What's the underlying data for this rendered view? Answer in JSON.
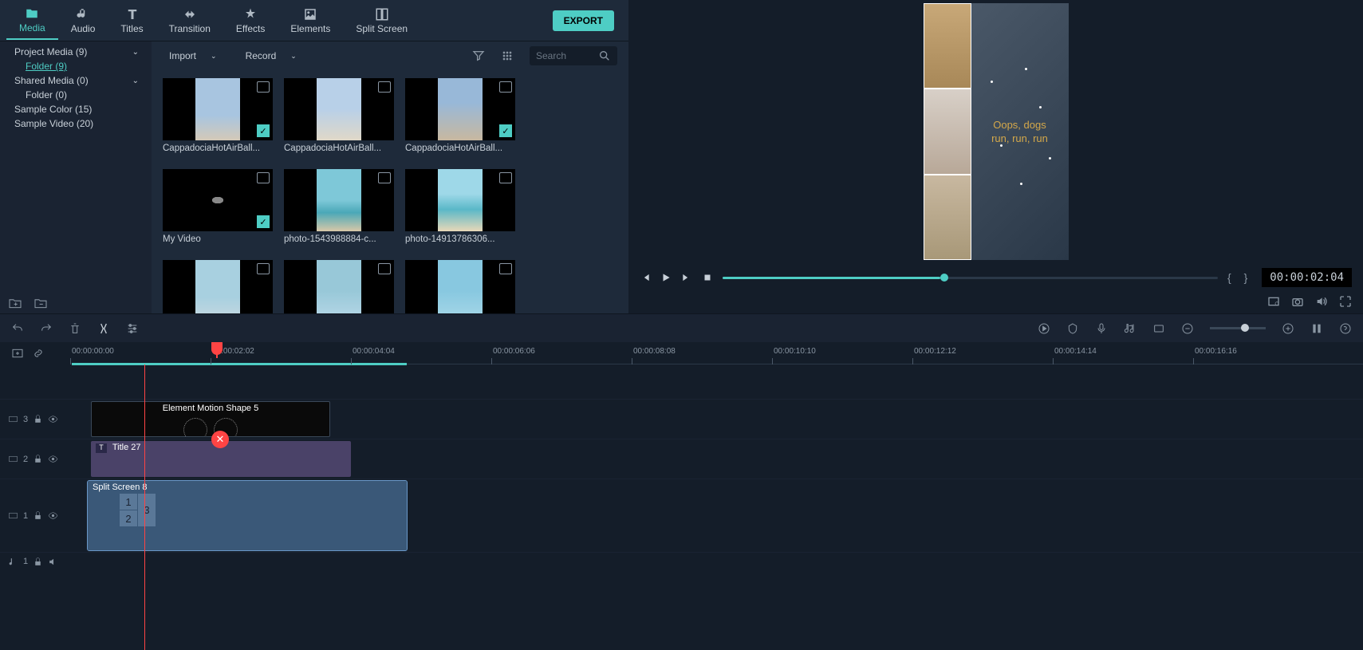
{
  "tabs": [
    "Media",
    "Audio",
    "Titles",
    "Transition",
    "Effects",
    "Elements",
    "Split Screen"
  ],
  "active_tab": 0,
  "export_label": "EXPORT",
  "sidebar": {
    "items": [
      {
        "label": "Project Media (9)",
        "expandable": true
      },
      {
        "label": "Folder (9)",
        "nested": true,
        "active": true
      },
      {
        "label": "Shared Media (0)",
        "expandable": true
      },
      {
        "label": "Folder (0)",
        "nested": true
      },
      {
        "label": "Sample Color (15)"
      },
      {
        "label": "Sample Video (20)"
      }
    ]
  },
  "media_toolbar": {
    "import_label": "Import",
    "record_label": "Record",
    "search_placeholder": "Search"
  },
  "media_items": [
    {
      "label": "CappadociaHotAirBall...",
      "thumb_class": "sky1",
      "type": "img",
      "checked": true
    },
    {
      "label": "CappadociaHotAirBall...",
      "thumb_class": "sky2",
      "type": "img"
    },
    {
      "label": "CappadociaHotAirBall...",
      "thumb_class": "sky3",
      "type": "img",
      "checked": true
    },
    {
      "label": "My Video",
      "thumb_class": "birds",
      "type": "vid",
      "checked": true,
      "wide": true
    },
    {
      "label": "photo-1543988884-c...",
      "thumb_class": "beach1",
      "type": "img"
    },
    {
      "label": "photo-14913786306...",
      "thumb_class": "beach2",
      "type": "img"
    },
    {
      "label": "",
      "thumb_class": "beach3",
      "type": "img"
    },
    {
      "label": "",
      "thumb_class": "beach4",
      "type": "img"
    },
    {
      "label": "",
      "thumb_class": "palm",
      "type": "img"
    }
  ],
  "preview": {
    "overlay_text_line1": "Oops, dogs",
    "overlay_text_line2": "run, run, run",
    "timecode": "00:00:02:04"
  },
  "ruler_marks": [
    "00:00:00:00",
    "00:00:02:02",
    "00:00:04:04",
    "00:00:06:06",
    "00:00:08:08",
    "00:00:10:10",
    "00:00:12:12",
    "00:00:14:14",
    "00:00:16:16"
  ],
  "tracks": {
    "t3": {
      "label": "3",
      "clip_label": "Element Motion Shape 5"
    },
    "t2": {
      "label": "2",
      "clip_label": "Title 27"
    },
    "t1": {
      "label": "1",
      "clip_label": "Split Screen 8"
    },
    "audio": {
      "label": "1"
    }
  },
  "split_cells": [
    "1",
    "2",
    "3"
  ]
}
